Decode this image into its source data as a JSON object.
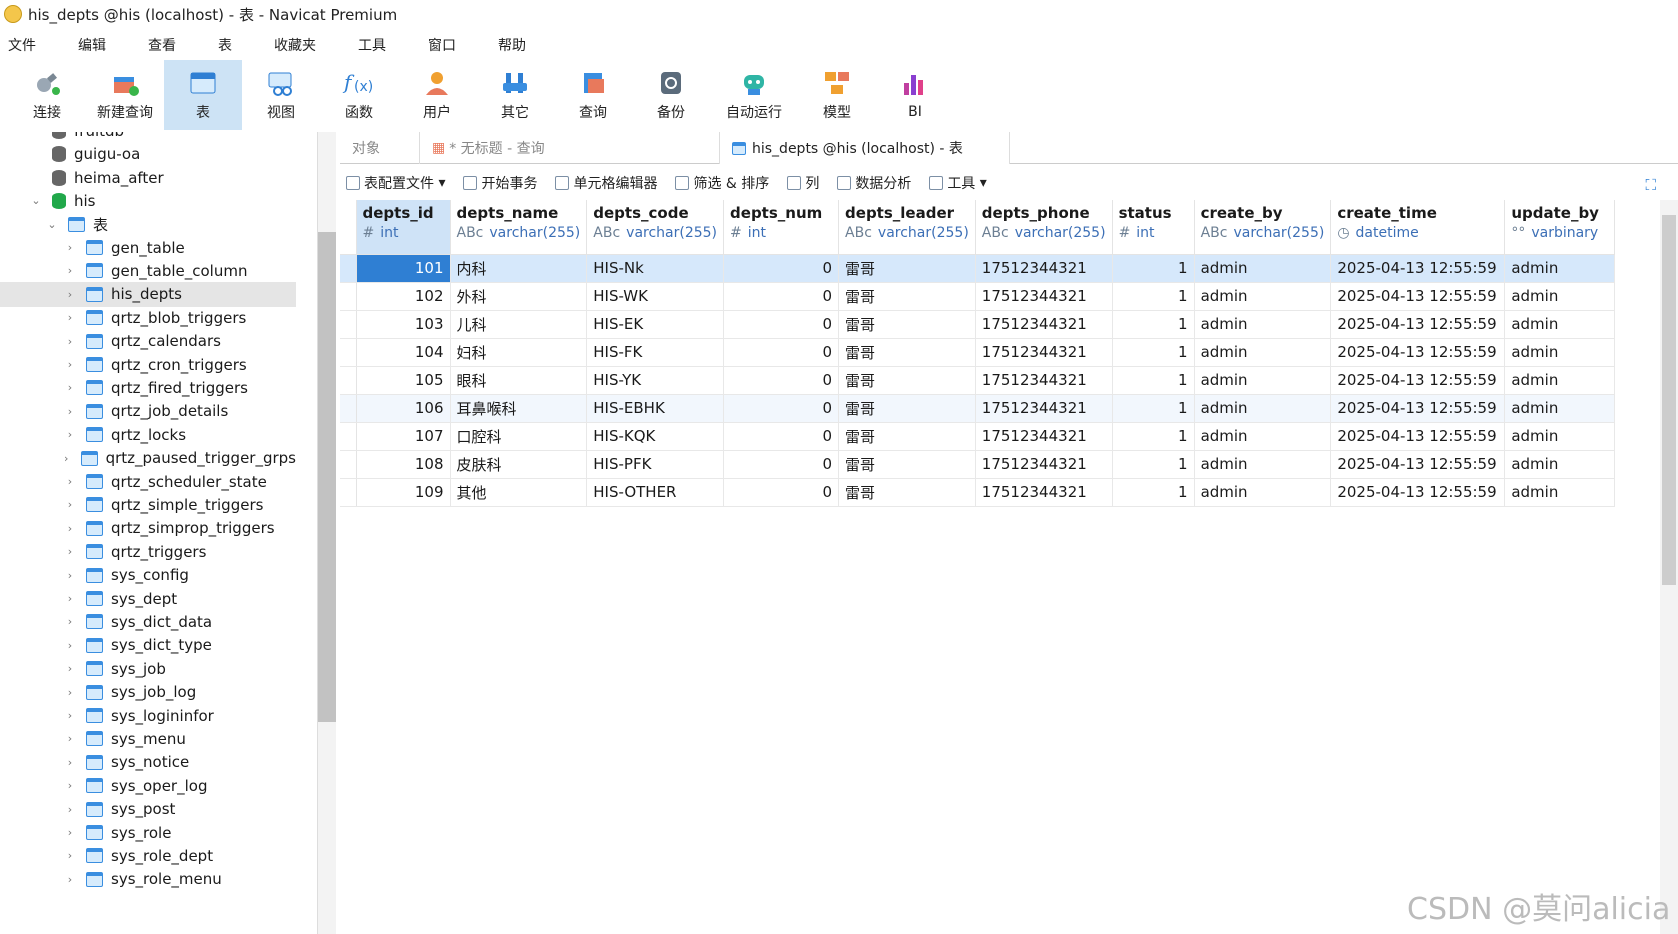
{
  "window": {
    "title": "his_depts @his (localhost) - 表 - Navicat Premium"
  },
  "menu": [
    "文件",
    "编辑",
    "查看",
    "表",
    "收藏夹",
    "工具",
    "窗口",
    "帮助"
  ],
  "toolbar": [
    {
      "label": "连接",
      "icon": "plug-icon"
    },
    {
      "label": "新建查询",
      "icon": "new-query-icon"
    },
    {
      "label": "表",
      "icon": "table-icon"
    },
    {
      "label": "视图",
      "icon": "view-icon"
    },
    {
      "label": "函数",
      "icon": "function-icon"
    },
    {
      "label": "用户",
      "icon": "user-icon"
    },
    {
      "label": "其它",
      "icon": "tools-icon"
    },
    {
      "label": "查询",
      "icon": "query-icon"
    },
    {
      "label": "备份",
      "icon": "backup-icon"
    },
    {
      "label": "自动运行",
      "icon": "robot-icon"
    },
    {
      "label": "模型",
      "icon": "model-icon"
    },
    {
      "label": "BI",
      "icon": "bi-icon"
    }
  ],
  "sidebar": {
    "dbs": [
      "fruitdb",
      "guigu-oa",
      "heima_after",
      "his"
    ],
    "group": "表",
    "tables": [
      "gen_table",
      "gen_table_column",
      "his_depts",
      "qrtz_blob_triggers",
      "qrtz_calendars",
      "qrtz_cron_triggers",
      "qrtz_fired_triggers",
      "qrtz_job_details",
      "qrtz_locks",
      "qrtz_paused_trigger_grps",
      "qrtz_scheduler_state",
      "qrtz_simple_triggers",
      "qrtz_simprop_triggers",
      "qrtz_triggers",
      "sys_config",
      "sys_dept",
      "sys_dict_data",
      "sys_dict_type",
      "sys_job",
      "sys_job_log",
      "sys_logininfor",
      "sys_menu",
      "sys_notice",
      "sys_oper_log",
      "sys_post",
      "sys_role",
      "sys_role_dept",
      "sys_role_menu"
    ]
  },
  "tabs": [
    "对象",
    "* 无标题 - 查询",
    "his_depts @his (localhost) - 表"
  ],
  "subtoolbar": [
    "表配置文件",
    "开始事务",
    "单元格编辑器",
    "筛选 & 排序",
    "列",
    "数据分析",
    "工具"
  ],
  "columns": [
    {
      "name": "depts_id",
      "type": "int",
      "sym": "#"
    },
    {
      "name": "depts_name",
      "type": "varchar(255)",
      "sym": "ABc"
    },
    {
      "name": "depts_code",
      "type": "varchar(255)",
      "sym": "ABc"
    },
    {
      "name": "depts_num",
      "type": "int",
      "sym": "#"
    },
    {
      "name": "depts_leader",
      "type": "varchar(255)",
      "sym": "ABc"
    },
    {
      "name": "depts_phone",
      "type": "varchar(255)",
      "sym": "ABc"
    },
    {
      "name": "status",
      "type": "int",
      "sym": "#"
    },
    {
      "name": "create_by",
      "type": "varchar(255)",
      "sym": "ABc"
    },
    {
      "name": "create_time",
      "type": "datetime",
      "sym": "◷"
    },
    {
      "name": "update_by",
      "type": "varbinary",
      "sym": "°°"
    }
  ],
  "rows": [
    [
      "101",
      "内科",
      "HIS-Nk",
      "0",
      "雷哥",
      "17512344321",
      "1",
      "admin",
      "2025-04-13 12:55:59",
      "admin"
    ],
    [
      "102",
      "外科",
      "HIS-WK",
      "0",
      "雷哥",
      "17512344321",
      "1",
      "admin",
      "2025-04-13 12:55:59",
      "admin"
    ],
    [
      "103",
      "儿科",
      "HIS-EK",
      "0",
      "雷哥",
      "17512344321",
      "1",
      "admin",
      "2025-04-13 12:55:59",
      "admin"
    ],
    [
      "104",
      "妇科",
      "HIS-FK",
      "0",
      "雷哥",
      "17512344321",
      "1",
      "admin",
      "2025-04-13 12:55:59",
      "admin"
    ],
    [
      "105",
      "眼科",
      "HIS-YK",
      "0",
      "雷哥",
      "17512344321",
      "1",
      "admin",
      "2025-04-13 12:55:59",
      "admin"
    ],
    [
      "106",
      "耳鼻喉科",
      "HIS-EBHK",
      "0",
      "雷哥",
      "17512344321",
      "1",
      "admin",
      "2025-04-13 12:55:59",
      "admin"
    ],
    [
      "107",
      "口腔科",
      "HIS-KQK",
      "0",
      "雷哥",
      "17512344321",
      "1",
      "admin",
      "2025-04-13 12:55:59",
      "admin"
    ],
    [
      "108",
      "皮肤科",
      "HIS-PFK",
      "0",
      "雷哥",
      "17512344321",
      "1",
      "admin",
      "2025-04-13 12:55:59",
      "admin"
    ],
    [
      "109",
      "其他",
      "HIS-OTHER",
      "0",
      "雷哥",
      "17512344321",
      "1",
      "admin",
      "2025-04-13 12:55:59",
      "admin"
    ]
  ],
  "watermark": "CSDN @莫问alicia"
}
